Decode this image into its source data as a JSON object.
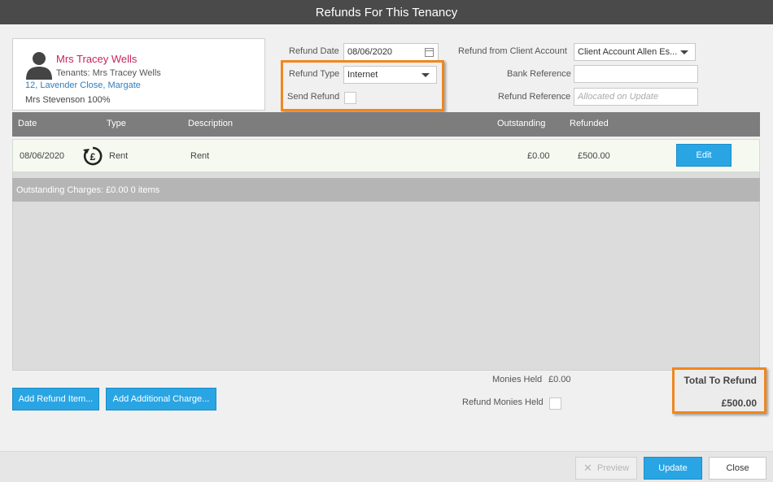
{
  "window": {
    "title": "Refunds For This Tenancy"
  },
  "tenant": {
    "name": "Mrs Tracey Wells",
    "tenants_line": "Tenants: Mrs Tracey Wells",
    "address": "12, Lavender Close, Margate",
    "owner": "Mrs Stevenson 100%"
  },
  "form": {
    "refund_date_label": "Refund Date",
    "refund_date_value": "08/06/2020",
    "refund_type_label": "Refund Type",
    "refund_type_value": "Internet",
    "send_refund_label": "Send Refund",
    "client_account_label": "Refund from Client Account",
    "client_account_value": "Client Account Allen Es...",
    "bank_reference_label": "Bank Reference",
    "bank_reference_value": "",
    "refund_reference_label": "Refund Reference",
    "refund_reference_placeholder": "Allocated on Update"
  },
  "table": {
    "headers": {
      "date": "Date",
      "type": "Type",
      "description": "Description",
      "outstanding": "Outstanding",
      "refunded": "Refunded"
    },
    "rows": [
      {
        "date": "08/06/2020",
        "type": "Rent",
        "description": "Rent",
        "outstanding": "£0.00",
        "refunded": "£500.00",
        "action": "Edit"
      }
    ],
    "outstanding_charges": "Outstanding Charges: £0.00 0 items"
  },
  "buttons": {
    "add_refund_item": "Add Refund Item...",
    "add_additional_charge": "Add Additional Charge...",
    "preview": "Preview",
    "update": "Update",
    "close": "Close"
  },
  "monies": {
    "held_label": "Monies Held",
    "held_value": "£0.00",
    "refund_held_label": "Refund Monies Held"
  },
  "total": {
    "label": "Total To Refund",
    "amount": "£500.00"
  },
  "colors": {
    "accent_blue": "#2aa5e4",
    "highlight_orange": "#f0871e",
    "tenant_name": "#c8245e",
    "link_blue": "#2d7fc0"
  },
  "icons": {
    "avatar": "person-silhouette-icon",
    "refund": "refund-pound-icon",
    "calendar": "calendar-icon",
    "preview": "close-x-icon"
  }
}
